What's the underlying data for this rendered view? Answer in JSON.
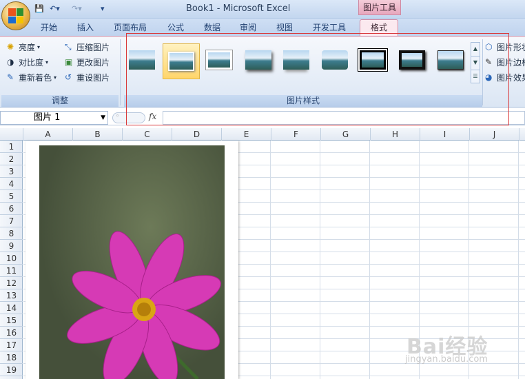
{
  "window": {
    "title": "Book1 - Microsoft Excel",
    "context_tab_group": "图片工具"
  },
  "ribbon_tabs": [
    "开始",
    "插入",
    "页面布局",
    "公式",
    "数据",
    "审阅",
    "视图",
    "开发工具",
    "格式"
  ],
  "adjust_group": {
    "label": "调整",
    "buttons": [
      {
        "label": "亮度",
        "icon": "brightness-icon"
      },
      {
        "label": "对比度",
        "icon": "contrast-icon"
      },
      {
        "label": "重新着色",
        "icon": "recolor-icon"
      },
      {
        "label": "压缩图片",
        "icon": "compress-icon"
      },
      {
        "label": "更改图片",
        "icon": "change-picture-icon"
      },
      {
        "label": "重设图片",
        "icon": "reset-picture-icon"
      }
    ]
  },
  "styles_group": {
    "label": "图片样式",
    "gallery_count": 9,
    "selected_index": 1,
    "side_buttons": [
      "图片形状",
      "图片边框",
      "图片效果"
    ]
  },
  "formula_bar": {
    "name_box": "图片 1",
    "fx": "fx",
    "formula": ""
  },
  "columns": [
    "A",
    "B",
    "C",
    "D",
    "E",
    "F",
    "G",
    "H",
    "I",
    "J"
  ],
  "rows": [
    "1",
    "2",
    "3",
    "4",
    "5",
    "6",
    "7",
    "8",
    "9",
    "10",
    "11",
    "12",
    "13",
    "14",
    "15",
    "16",
    "17",
    "18",
    "19"
  ],
  "watermark": {
    "main": "Bai经验",
    "sub": "jingyan.baidu.com"
  }
}
